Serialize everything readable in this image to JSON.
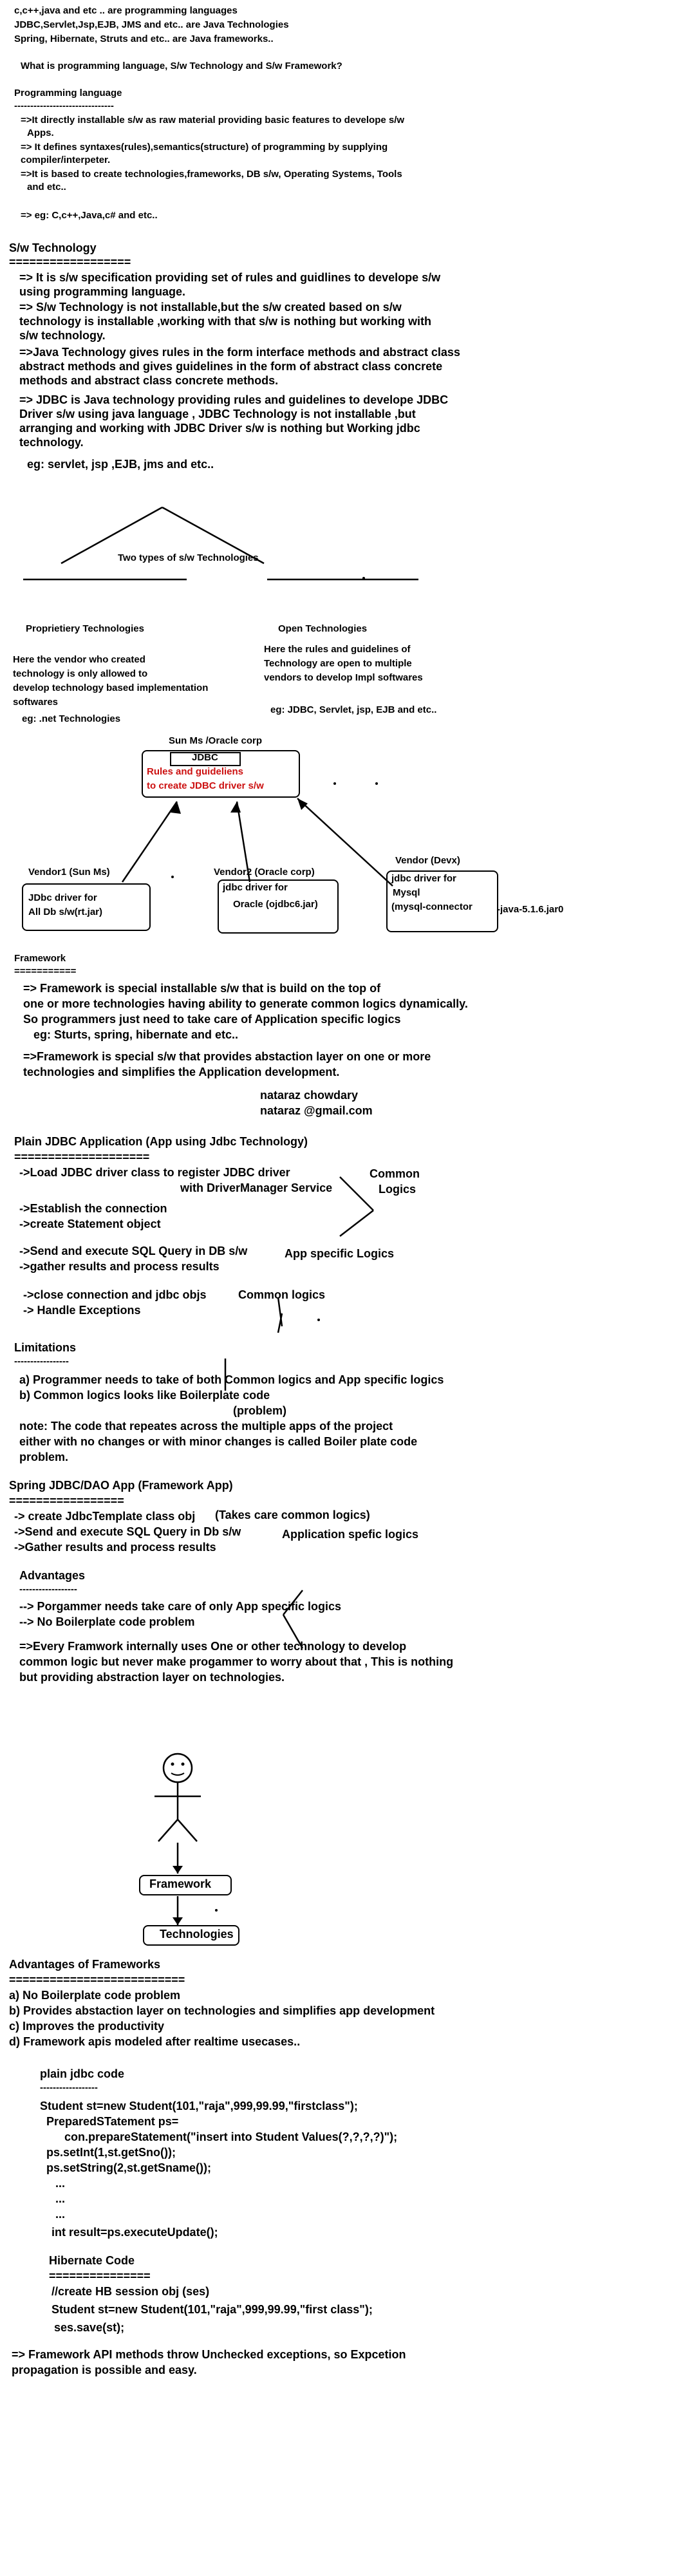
{
  "header": {
    "l1": "c,c++,java and etc .. are  programming languages",
    "l2": "JDBC,Servlet,Jsp,EJB, JMS and etc.. are  Java Technologies",
    "l3": "Spring, Hibernate, Struts and etc.. are Java frameworks..",
    "question": "What is programming language, S/w Technology and S/w Framework?"
  },
  "pl": {
    "title": "Programming language",
    "rule": "-------------------------------",
    "p1a": "=>It directly installable s/w as raw material providing basic features to develope s/w",
    "p1b": "Apps.",
    "p2a": "=> It defines syntaxes(rules),semantics(structure) of programming by supplying",
    "p2b": "compiler/interpeter.",
    "p3a": "=>It is based to create technologies,frameworks, DB s/w, Operating Systems, Tools",
    "p3b": "and etc..",
    "eg": "=> eg: C,c++,Java,c# and etc.."
  },
  "swt": {
    "title": "S/w Technology",
    "rule": "==================",
    "a1": "=> It is s/w specification providing set of rules and guidlines to  develope s/w",
    "a2": "using programming language.",
    "b1": "=> S/w Technology is not installable,but the s/w created based on s/w",
    "b2": "technology is installable ,working with that s/w is nothing but working with",
    "b3": "s/w technology.",
    "c1": "=>Java Technology gives rules in the form interface methods and abstract class",
    "c2": "abstract methods and gives guidelines in the form of abstract class concrete",
    "c3": "methods  and abstract class concrete methods.",
    "d1": "=> JDBC is Java technology providing rules and guidelines to develope JDBC",
    "d2": "Driver s/w using java language , JDBC Technology is not installable ,but",
    "d3": "arranging and working with JDBC Driver s/w is nothing but Working jdbc",
    "d4": "technology.",
    "eg": "eg:  servlet, jsp ,EJB, jms and etc.."
  },
  "diagram1": {
    "types": "Two types of s/w Technologies",
    "prop_title": "Proprietiery Technologies",
    "prop1": "Here the vendor who created",
    "prop2": "technology is only allowed to",
    "prop3": "develop technology based implementation",
    "prop4": "softwares",
    "prop_eg": "eg:  .net  Technologies",
    "open_title": "Open Technologies",
    "open1": "Here the rules and guidelines of",
    "open2": "Technology are open to multiple",
    "open3": "vendors  to develop Impl softwares",
    "open_eg": "eg: JDBC, Servlet, jsp, EJB and etc..",
    "sun": "Sun Ms /Oracle corp",
    "jdbc": "JDBC",
    "rules1": "Rules and  guideliens",
    "rules2": "to create  JDBC driver s/w",
    "v1_title": "Vendor1 (Sun Ms)",
    "v1a": "JDbc driver for",
    "v1b": "All Db s/w(rt.jar)",
    "v2_title": "Vendor2 (Oracle corp)",
    "v2a": "jdbc driver for",
    "v2b": "Oracle (ojdbc6.jar)",
    "v3_title": "Vendor (Devx)",
    "v3a": "jdbc driver for",
    "v3b": "Mysql",
    "v3c": "(mysql-connector",
    "v3d": "-java-5.1.6.jar0"
  },
  "fw": {
    "title": "Framework",
    "rule": "===========",
    "a1": "=> Framework is special installable s/w that is build on the top of",
    "a2": "one or more technologies having ability to generate common logics dynamically.",
    "a3": "So programmers just need to take care of Application specific logics",
    "a4": "eg:  Sturts, spring, hibernate and etc..",
    "b1": "=>Framework is special s/w that provides abstaction layer on one or more",
    "b2": "technologies and simplifies the Application development.",
    "author1": "nataraz chowdary",
    "author2": "nataraz @gmail.com"
  },
  "plain": {
    "title": "Plain JDBC Application    (App using Jdbc Technology)",
    "rule": "====================",
    "s1": "->Load JDBC driver class to register JDBC driver",
    "s1b": "with DriverManager Service",
    "s2": "->Establish the connection",
    "s3": "->create Statement object",
    "common1": "Common",
    "common2": "Logics",
    "s4": "->Send and execute SQL Query in DB s/w",
    "s5": "->gather results and process results",
    "app": "App specific Logics",
    "s6": "->close connection and jdbc objs",
    "s7": "-> Handle Exceptions",
    "common3": "Common logics"
  },
  "lim": {
    "title": "Limitations",
    "rule": "-----------------",
    "a": "a) Programmer needs to take of both Common logics and App specific logics",
    "b": "b) Common logics looks like  Boilerplate code",
    "prob": "(problem)",
    "n1": "note: The code that repeates across the multiple apps of the project",
    "n2": "either with no changes or with minor changes is called Boiler plate code",
    "n3": "problem."
  },
  "spring": {
    "title": "Spring JDBC/DAO  App  (Framework App)",
    "rule": "=================",
    "s1": "-> create JdbcTemplate class obj",
    "common": "(Takes care common logics)",
    "s2": "->Send and execute SQL Query in Db s/w",
    "app": "Application spefic logics",
    "s3": "->Gather results and process results",
    "adv": "Advantages",
    "adv_rule": "------------------",
    "a1": "--> Porgammer needs take care of only App specific logics",
    "a2": "--> No Boilerplate code problem",
    "e1": "=>Every Framwork internally uses One or other technology to develop",
    "e2": "common  logic but never make progammer to worry about that , This is nothing",
    "e3": "but providing  abstraction layer on technologies."
  },
  "stick": {
    "framework": "Framework",
    "technologies": "Technologies"
  },
  "advfw": {
    "title": "Advantages of Frameworks",
    "rule": "==========================",
    "a": "a) No Boilerplate code problem",
    "b": "b) Provides abstaction layer on technologies and simplifies  app development",
    "c": "c)  Improves the productivity",
    "d": "d) Framework apis modeled after realtime usecases.."
  },
  "code": {
    "plain_title": "plain jdbc code",
    "plain_rule": "------------------",
    "c1": "Student st=new Student(101,\"raja\",999,99.99,\"firstclass\");",
    "c2": "PreparedSTatement ps=",
    "c3": "con.prepareStatement(\"insert into Student Values(?,?,?,?)\");",
    "c4": "ps.setInt(1,st.getSno());",
    "c5": "ps.setString(2,st.getSname());",
    "dots": "...",
    "c6": "int result=ps.executeUpdate();",
    "hb_title": "Hibernate Code",
    "hb_rule": "===============",
    "h1": "//create HB session obj (ses)",
    "h2": "Student st=new Student(101,\"raja\",999,99.99,\"first class\");",
    "h3": "ses.save(st);",
    "f1": "=> Framework API methods throw Unchecked exceptions, so Expcetion",
    "f2": "propagation is possible and easy."
  }
}
